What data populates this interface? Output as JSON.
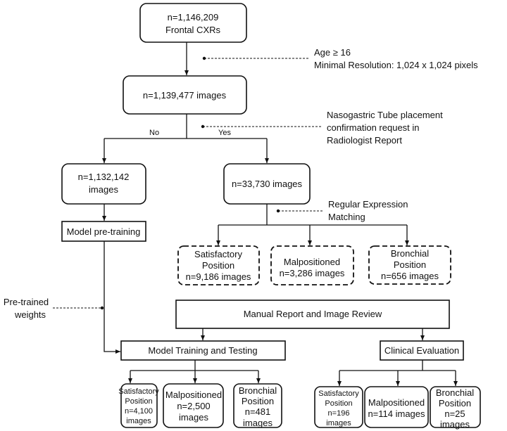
{
  "boxes": {
    "total": [
      "n=1,146,209",
      "Frontal CXRs"
    ],
    "filtered": "n=1,139,477 images",
    "no_branch": [
      "n=1,132,142",
      "images"
    ],
    "yes_branch": "n=33,730 images",
    "pretraining": "Model pre-training",
    "regex_satisfactory": [
      "Satisfactory",
      "Position",
      "n=9,186 images"
    ],
    "regex_malpositioned": [
      "Malpositioned",
      "n=3,286 images"
    ],
    "regex_bronchial": [
      "Bronchial",
      "Position",
      "n=656 images"
    ],
    "manual_review": "Manual Report and Image Review",
    "training": "Model Training and Testing",
    "clinical": "Clinical Evaluation",
    "train_satisfactory": [
      "Satisfactory",
      "Position",
      "n=4,100",
      "images"
    ],
    "train_malpositioned": [
      "Malpositioned",
      "n=2,500",
      "images"
    ],
    "train_bronchial": [
      "Bronchial",
      "Position",
      "n=481",
      "images"
    ],
    "clin_satisfactory": [
      "Satisfactory",
      "Position",
      "n=196",
      "images"
    ],
    "clin_malpositioned": [
      "Malpositioned",
      "n=114 images"
    ],
    "clin_bronchial": [
      "Bronchial",
      "Position",
      "n=25",
      "images"
    ]
  },
  "annotations": {
    "filter": [
      "Age ≥ 16",
      "Minimal Resolution: 1,024 x 1,024 pixels"
    ],
    "ngt_request": [
      "Nasogastric Tube placement",
      "confirmation request in",
      "Radiologist Report"
    ],
    "regex": [
      "Regular Expression",
      "Matching"
    ],
    "pretrained": [
      "Pre-trained",
      "weights"
    ],
    "no": "No",
    "yes": "Yes"
  }
}
